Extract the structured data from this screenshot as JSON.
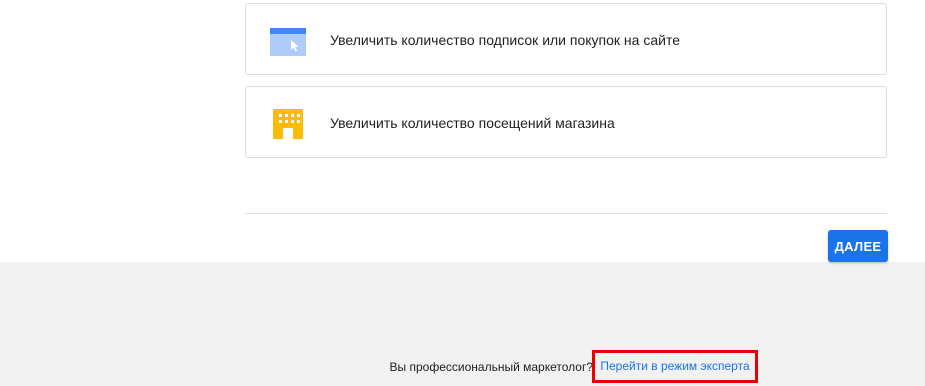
{
  "goals": [
    {
      "icon": "website-browser-icon",
      "label": "Увеличить количество подписок или покупок на сайте"
    },
    {
      "icon": "store-building-icon",
      "label": "Увеличить количество посещений магазина"
    }
  ],
  "actions": {
    "next_label": "ДАЛЕЕ"
  },
  "footer": {
    "question": "Вы профессиональный маркетолог?",
    "expert_link": "Перейти в режим эксперта"
  },
  "colors": {
    "accent": "#1a73e8",
    "highlight_box": "#ee0000",
    "store_icon": "#fbbc04",
    "browser_icon": "#4285f4"
  }
}
